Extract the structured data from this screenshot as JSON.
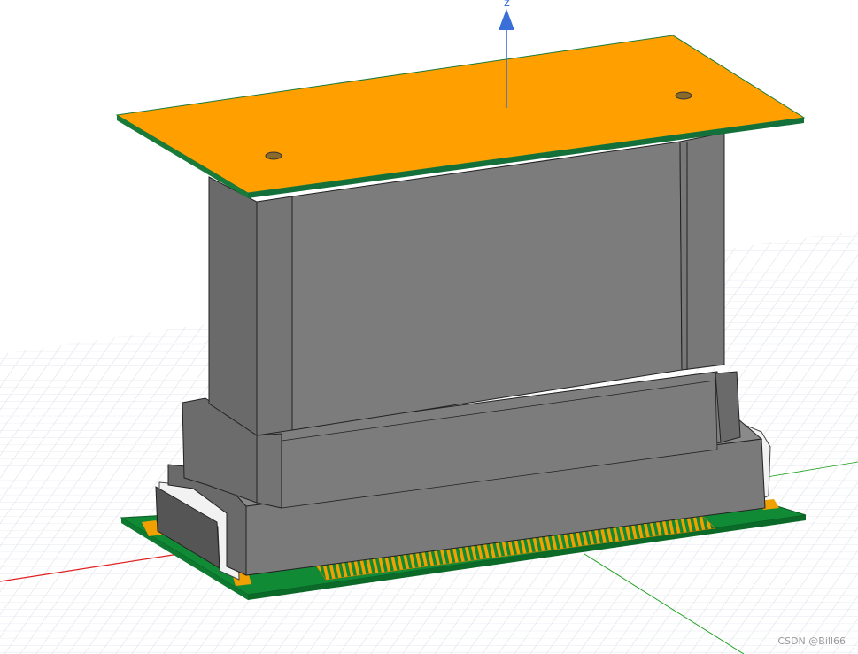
{
  "viewport": {
    "z_axis_label": "z",
    "watermark": "CSDN @Bill66"
  },
  "colors": {
    "background": "#ffffff",
    "grid": "#d7dce6",
    "pcb_top": "#ffa000",
    "pcb_edge": "#1a7a3a",
    "pcb_bottom": "#118a35",
    "connector_body": "#7c7c7c",
    "connector_dark": "#5f5f5f",
    "connector_light": "#8a8a8a",
    "pins": "#f0a000",
    "x_axis": "#e02020",
    "y_axis": "#20a020",
    "z_axis": "#3a6fd8"
  },
  "icons": [
    "z-axis-arrow-icon"
  ]
}
